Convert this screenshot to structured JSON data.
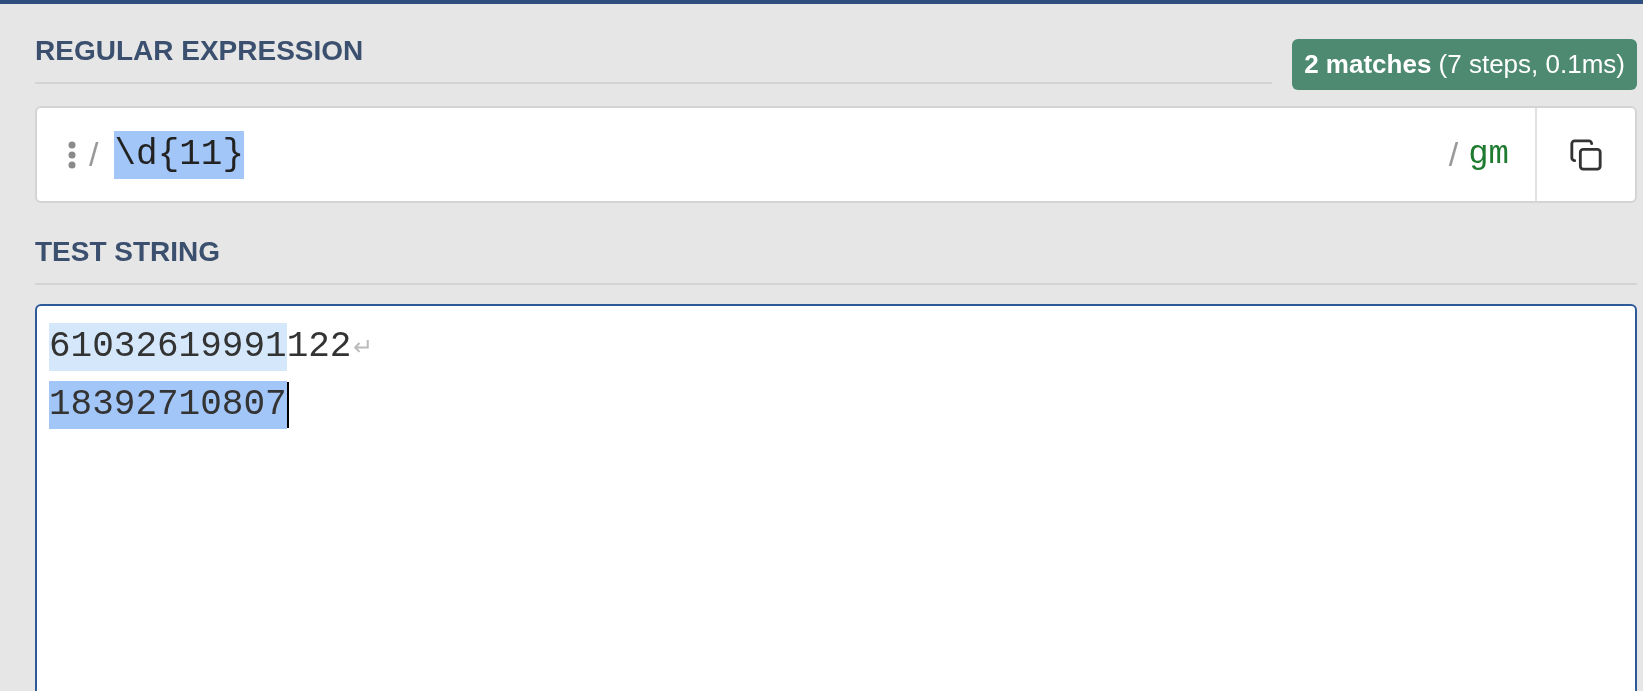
{
  "regex_section": {
    "title": "REGULAR EXPRESSION",
    "result_badge": "**2 matches** (7 steps, 0.1ms)"
  },
  "regex_field": {
    "open_delimiter": "/",
    "pattern": "\\d{11}",
    "pattern_selected": true,
    "close_delimiter": "/",
    "flags": "gm"
  },
  "test_section": {
    "title": "TEST STRING"
  },
  "test_lines": [
    {
      "segments": [
        {
          "kind": "match",
          "text": "61032619991"
        },
        {
          "kind": "plain",
          "text": "122"
        }
      ],
      "newline_mark": "↵",
      "cursor": false
    },
    {
      "segments": [
        {
          "kind": "active-match",
          "text": "18392710807"
        }
      ],
      "cursor": true
    }
  ]
}
